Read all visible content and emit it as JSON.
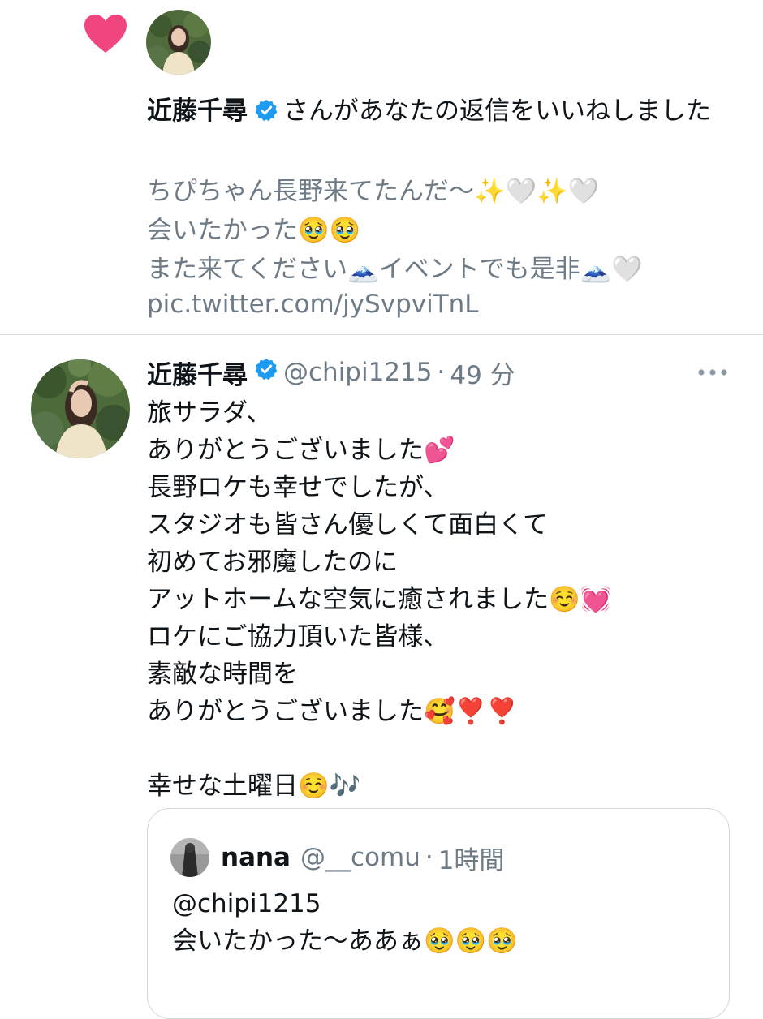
{
  "notification": {
    "icon": "heart-icon",
    "icon_color": "#f0457f",
    "actor_name": "近藤千尋",
    "action_text": "さんがあなたの返信をいいねしました",
    "preview_text": "ちぴちゃん長野来てたんだ〜✨🤍✨🤍\n会いたかった🥹🥹\nまた来てください🗻イベントでも是非🗻🤍",
    "link_text": "pic.twitter.com/jySvpviTnL"
  },
  "tweet": {
    "author_name": "近藤千尋",
    "handle": "@chipi1215",
    "separator": "·",
    "time": "49 分",
    "more_icon": "more-icon",
    "body": "旅サラダ、\nありがとうございました💕\n長野ロケも幸せでしたが、\nスタジオも皆さん優しくて面白くて\n初めてお邪魔したのに\nアットホームな空気に癒されました☺️💓\nロケにご協力頂いた皆様、\n素敵な時間を\nありがとうございました🥰❣️❣️\n\n幸せな土曜日☺️🎶"
  },
  "quoted_tweet": {
    "author_name": "nana",
    "handle": "@__comu",
    "separator": "·",
    "time": "1時間",
    "body": "@chipi1215\n会いたかった〜ああぁ🥹🥹🥹"
  },
  "colors": {
    "verified": "#1d9bf0",
    "secondary_text": "#6e7b86",
    "divider": "#d9dee2"
  }
}
